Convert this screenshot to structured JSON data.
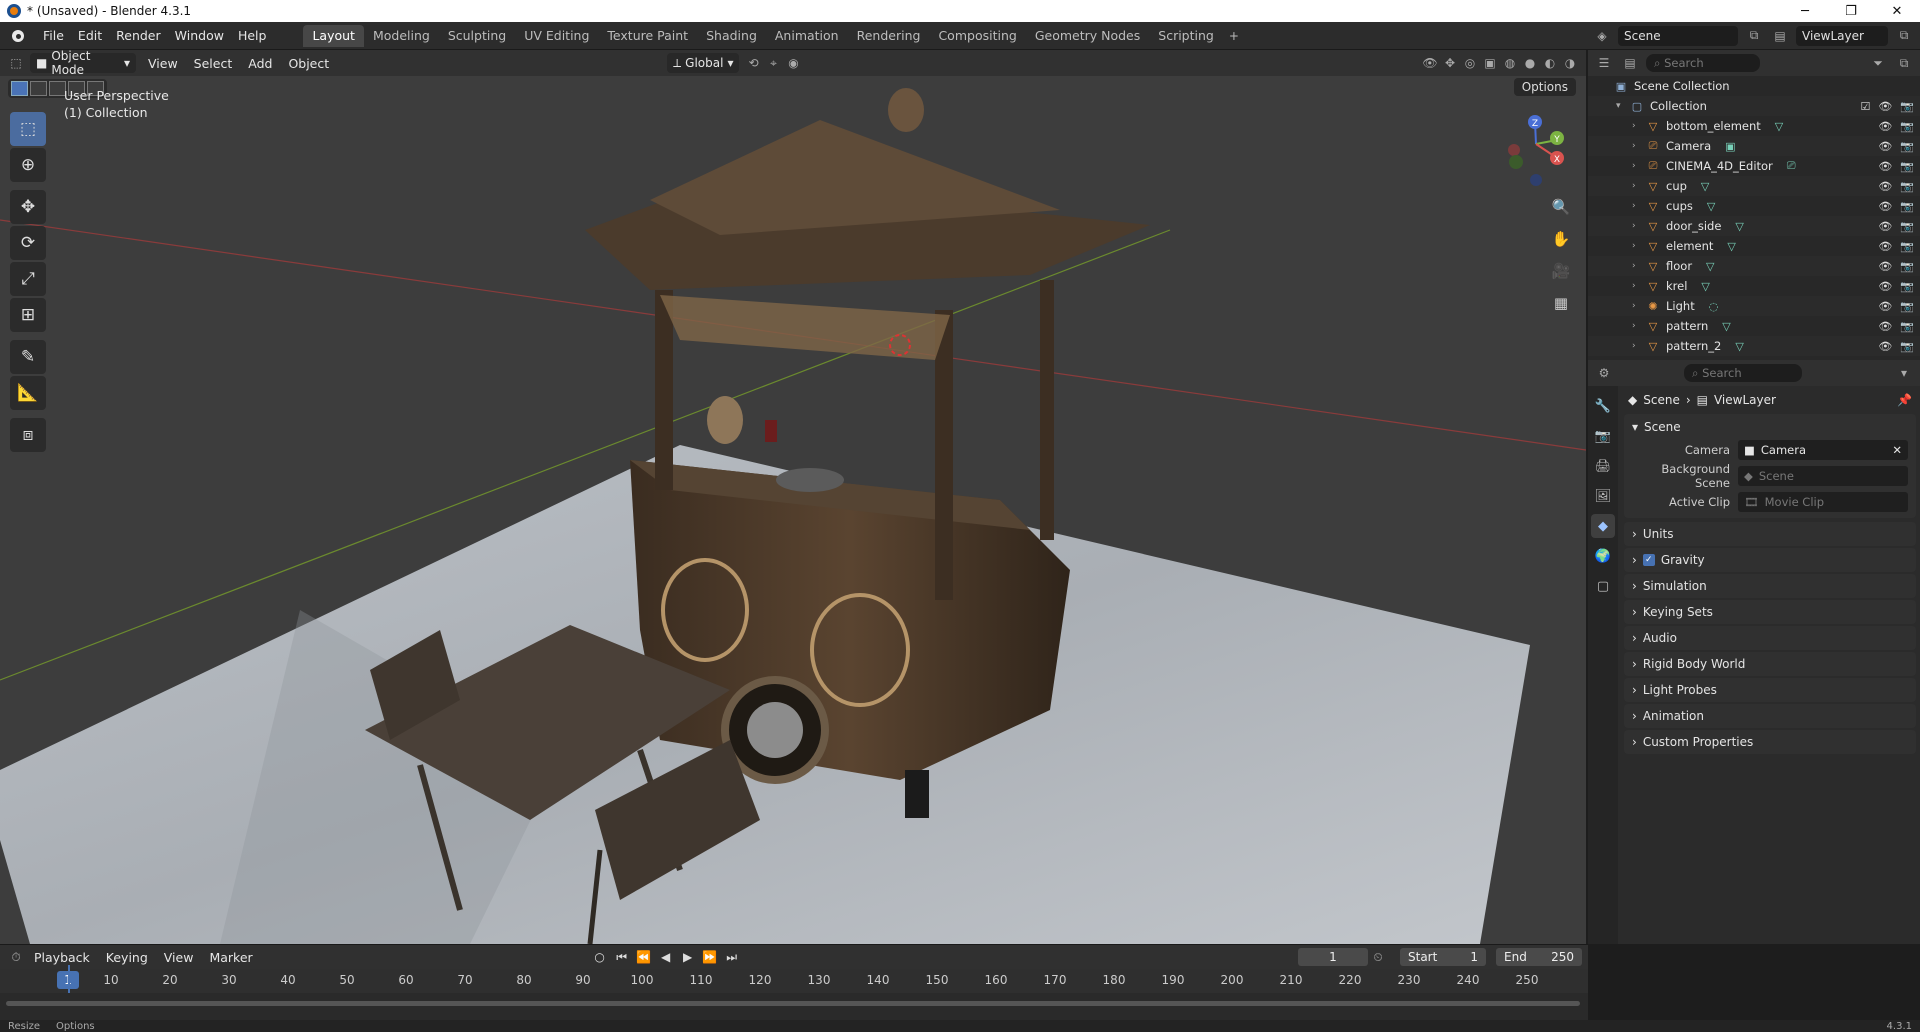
{
  "window": {
    "title": "* (Unsaved) - Blender 4.3.1",
    "minimize": "─",
    "maximize": "❐",
    "close": "✕"
  },
  "menu": {
    "items": [
      "File",
      "Edit",
      "Render",
      "Window",
      "Help"
    ]
  },
  "workspaces": {
    "tabs": [
      "Layout",
      "Modeling",
      "Sculpting",
      "UV Editing",
      "Texture Paint",
      "Shading",
      "Animation",
      "Rendering",
      "Compositing",
      "Geometry Nodes",
      "Scripting"
    ],
    "active": "Layout",
    "add": "+"
  },
  "topright": {
    "scene": "Scene",
    "viewlayer": "ViewLayer"
  },
  "viewport": {
    "mode": "Object Mode",
    "menus": [
      "View",
      "Select",
      "Add",
      "Object"
    ],
    "transform": "Global",
    "options": "Options",
    "perspective": "User Perspective",
    "collection": "(1) Collection",
    "gizmo": {
      "x": "X",
      "y": "Y",
      "z": "Z"
    }
  },
  "outliner": {
    "search_placeholder": "Search",
    "root": "Scene Collection",
    "collection": "Collection",
    "objects": [
      {
        "name": "bottom_element",
        "icon": "mesh-icon"
      },
      {
        "name": "Camera",
        "icon": "camera-icon"
      },
      {
        "name": "CINEMA_4D_Editor",
        "icon": "camera-icon"
      },
      {
        "name": "cup",
        "icon": "mesh-icon"
      },
      {
        "name": "cups",
        "icon": "mesh-icon"
      },
      {
        "name": "door_side",
        "icon": "mesh-icon"
      },
      {
        "name": "element",
        "icon": "mesh-icon"
      },
      {
        "name": "floor",
        "icon": "mesh-icon"
      },
      {
        "name": "krel",
        "icon": "mesh-icon"
      },
      {
        "name": "Light",
        "icon": "light-icon"
      },
      {
        "name": "pattern",
        "icon": "mesh-icon"
      },
      {
        "name": "pattern_2",
        "icon": "mesh-icon"
      }
    ]
  },
  "properties": {
    "search_placeholder": "Search",
    "breadcrumb": {
      "scene": "Scene",
      "viewlayer": "ViewLayer"
    },
    "scene_panel": {
      "title": "Scene",
      "camera_label": "Camera",
      "camera_value": "Camera",
      "bg_label": "Background Scene",
      "bg_placeholder": "Scene",
      "clip_label": "Active Clip",
      "clip_placeholder": "Movie Clip"
    },
    "subpanels": [
      "Units",
      "Gravity",
      "Simulation",
      "Keying Sets",
      "Audio",
      "Rigid Body World",
      "Light Probes",
      "Animation",
      "Custom Properties"
    ],
    "gravity_checked": true
  },
  "timeline": {
    "menus": [
      "Playback",
      "Keying",
      "View",
      "Marker"
    ],
    "current_frame": "1",
    "start_label": "Start",
    "start": "1",
    "end_label": "End",
    "end": "250",
    "ticks": [
      "10",
      "20",
      "30",
      "40",
      "50",
      "60",
      "70",
      "80",
      "90",
      "100",
      "110",
      "120",
      "130",
      "140",
      "150",
      "160",
      "170",
      "180",
      "190",
      "200",
      "210",
      "220",
      "230",
      "240",
      "250"
    ],
    "cursor": "1"
  },
  "status": {
    "left1": "Resize",
    "left2": "Options",
    "version": "4.3.1"
  },
  "colors": {
    "accent": "#4772b3",
    "object": "#e89846",
    "data": "#78d0b8"
  }
}
